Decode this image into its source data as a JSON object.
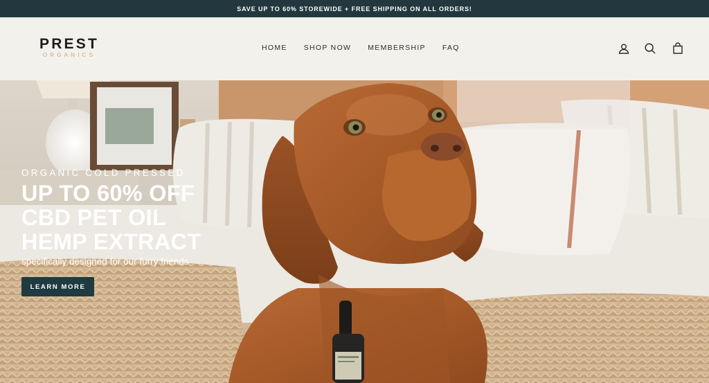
{
  "announcement": {
    "text": "SAVE UP TO 60% STOREWIDE + FREE SHIPPING ON ALL ORDERS!"
  },
  "header": {
    "logo": {
      "main": "PREST",
      "sub": "ORGANICS"
    },
    "nav": [
      {
        "label": "HOME"
      },
      {
        "label": "SHOP NOW"
      },
      {
        "label": "MEMBERSHIP"
      },
      {
        "label": "FAQ"
      }
    ],
    "icons": [
      "account-icon",
      "search-icon",
      "cart-icon"
    ]
  },
  "hero": {
    "eyebrow": "ORGANIC COLD PRESSED",
    "headline": [
      "UP TO 60% OFF",
      "CBD PET OIL",
      "HEMP EXTRACT"
    ],
    "subline": "specifically designed for our furry friends",
    "cta_label": "LEARN MORE"
  },
  "colors": {
    "announce_bg": "#22383e",
    "header_bg": "#f3f1ec",
    "cta_bg": "#1f3a40",
    "logo_accent": "#c9a77a"
  }
}
